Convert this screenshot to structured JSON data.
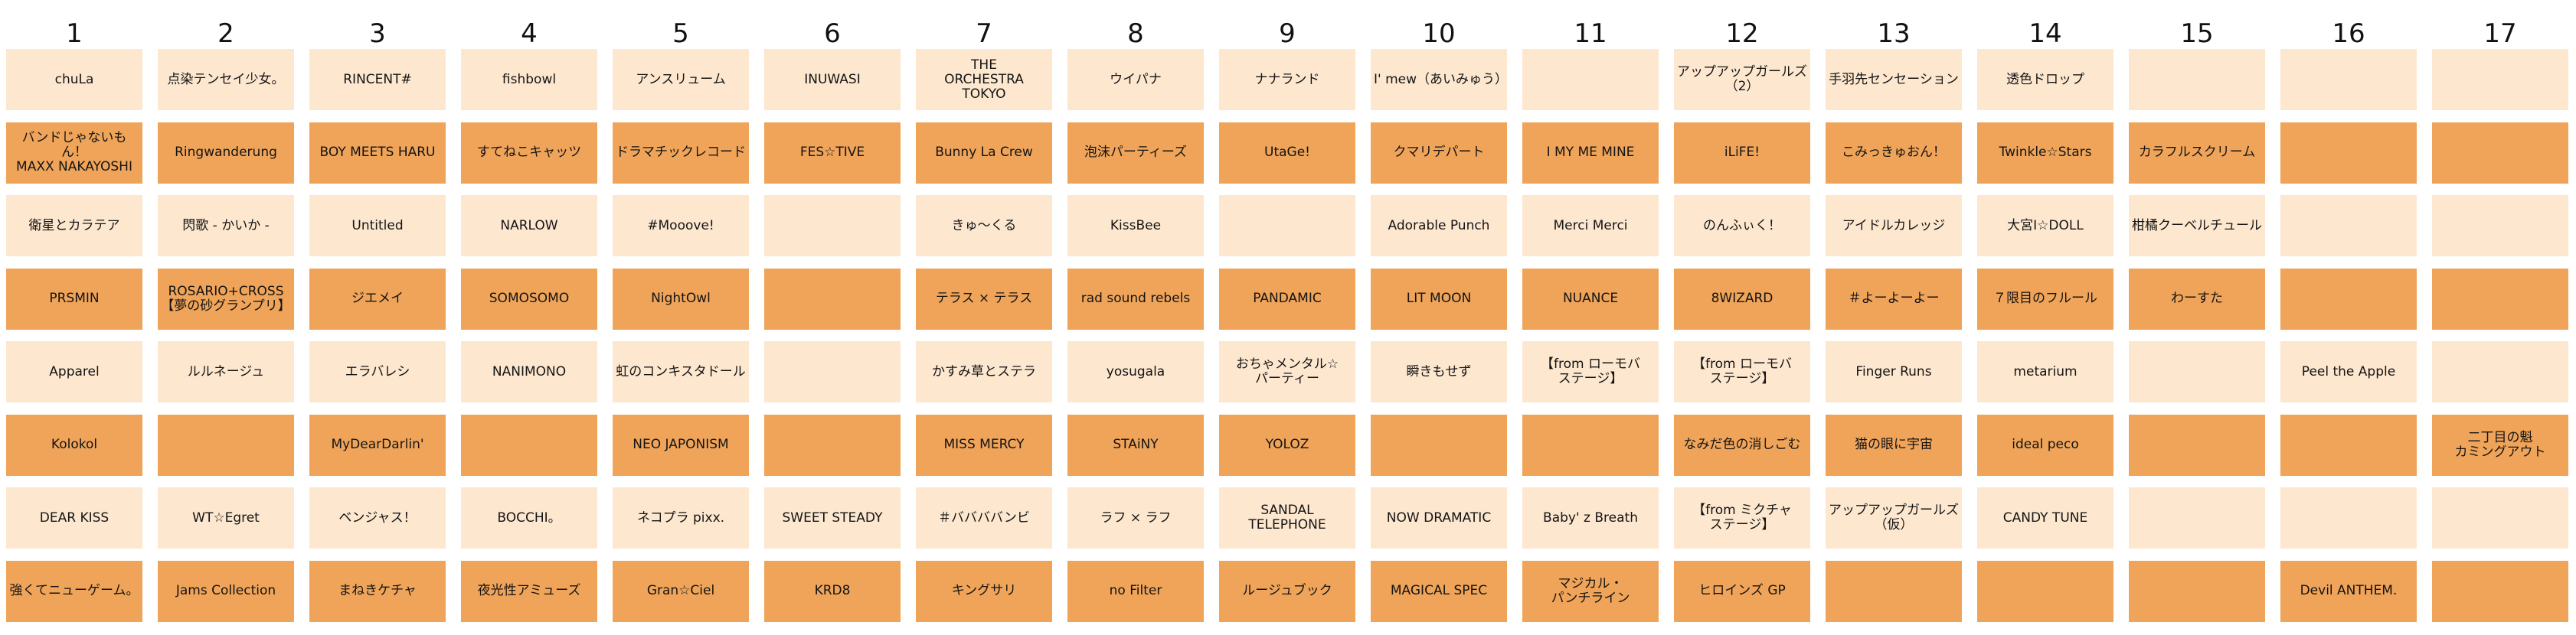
{
  "colors": {
    "light_row": "#fde7cf",
    "dark_row": "#efa459",
    "text": "#141414"
  },
  "columns": [
    "1",
    "2",
    "3",
    "4",
    "5",
    "6",
    "7",
    "8",
    "9",
    "10",
    "11",
    "12",
    "13",
    "14",
    "15",
    "16",
    "17"
  ],
  "rows": [
    [
      "chuLa",
      "点染テンセイ少女。",
      "RINCENT#",
      "fishbowl",
      "アンスリューム",
      "INUWASI",
      "THE\nORCHESTRA\nTOKYO",
      "ウイパナ",
      "ナナランド",
      "I' mew（あいみゅう）",
      "",
      "アップアップガールズ\n（2）",
      "手羽先センセーション",
      "透色ドロップ",
      "",
      "",
      ""
    ],
    [
      "バンドじゃないもん！\nMAXX NAKAYOSHI",
      "Ringwanderung",
      "BOY MEETS HARU",
      "すてねこキャッツ",
      "ドラマチックレコード",
      "FES☆TIVE",
      "Bunny La Crew",
      "泡沫パーティーズ",
      "UtaGe!",
      "クマリデパート",
      "I MY ME MINE",
      "iLiFE!",
      "こみっきゅおん！",
      "Twinkle☆Stars",
      "カラフルスクリーム",
      "",
      ""
    ],
    [
      "衛星とカラテア",
      "閃歌 - かいか -",
      "Untitled",
      "NARLOW",
      "#Mooove!",
      "",
      "きゅ～くる",
      "KissBee",
      "",
      "Adorable Punch",
      "Merci Merci",
      "のんふぃく！",
      "アイドルカレッジ",
      "大宮I☆DOLL",
      "柑橘クーベルチュール",
      "",
      ""
    ],
    [
      "PRSMIN",
      "ROSARIO+CROSS\n【夢の砂グランプリ】",
      "ジエメイ",
      "SOMOSOMO",
      "NightOwl",
      "",
      "テラス × テラス",
      "rad sound rebels",
      "PANDAMIC",
      "LIT MOON",
      "NUANCE",
      "8WIZARD",
      "＃よーよーよー",
      "７限目のフルール",
      "わーすた",
      "",
      ""
    ],
    [
      "Apparel",
      "ルルネージュ",
      "エラバレシ",
      "NANIMONO",
      "虹のコンキスタドール",
      "",
      "かすみ草とステラ",
      "yosugala",
      "おちゃメンタル☆\nパーティー",
      "瞬きもせず",
      "【from ローモバ\nステージ】",
      "【from ローモバ\nステージ】",
      "Finger Runs",
      "metarium",
      "",
      "Peel the Apple",
      ""
    ],
    [
      "Kolokol",
      "",
      "MyDearDarlin'",
      "",
      "NEO JAPONISM",
      "",
      "MISS MERCY",
      "STAiNY",
      "YOLOZ",
      "",
      "",
      "なみだ色の消しごむ",
      "猫の眼に宇宙",
      "ideal peco",
      "",
      "",
      "二丁目の魁\nカミングアウト"
    ],
    [
      "DEAR KISS",
      "WT☆Egret",
      "ベンジャス！",
      "BOCCHI。",
      "ネコプラ pixx.",
      "SWEET STEADY",
      "＃ババババンビ",
      "ラフ × ラフ",
      "SANDAL TELEPHONE",
      "NOW DRAMATIC",
      "Baby' z Breath",
      "【from ミクチャ\nステージ】",
      "アップアップガールズ\n（仮）",
      "CANDY TUNE",
      "",
      "",
      ""
    ],
    [
      "強くてニューゲーム。",
      "Jams Collection",
      "まねきケチャ",
      "夜光性アミューズ",
      "Gran☆Ciel",
      "KRD8",
      "キングサリ",
      "no Filter",
      "ルージュブック",
      "MAGICAL SPEC",
      "マジカル・\nパンチライン",
      "ヒロインズ GP",
      "",
      "",
      "",
      "Devil ANTHEM.",
      ""
    ]
  ]
}
